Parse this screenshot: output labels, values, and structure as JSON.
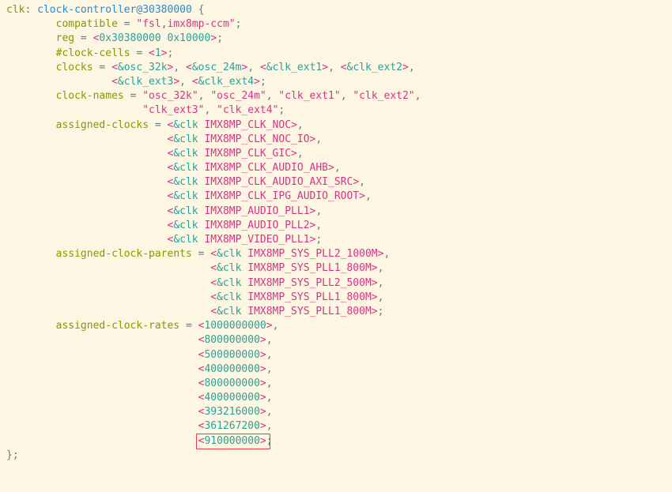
{
  "line1": {
    "label": "clk",
    "colon": ": ",
    "node": "clock-controller@30380000",
    "brace": " {"
  },
  "compatible": {
    "prop": "compatible",
    "eq": " = ",
    "q1": "\"fsl,imx8mp-ccm\"",
    "semi": ";"
  },
  "reg": {
    "prop": "reg",
    "eq": " = ",
    "lt": "<",
    "v": "0x30380000 0x10000",
    "gt": ">",
    "semi": ";"
  },
  "cells": {
    "prop": "#clock-cells",
    "eq": " = ",
    "lt": "<",
    "v": "1",
    "gt": ">",
    "semi": ";"
  },
  "clocks": {
    "prop": "clocks",
    "eq": " = ",
    "e1": {
      "lt": "<",
      "amp": "&osc_32k",
      "gt": ">"
    },
    "e2": {
      "lt": "<",
      "amp": "&osc_24m",
      "gt": ">"
    },
    "e3": {
      "lt": "<",
      "amp": "&clk_ext1",
      "gt": ">"
    },
    "e4": {
      "lt": "<",
      "amp": "&clk_ext2",
      "gt": ">"
    },
    "e5": {
      "lt": "<",
      "amp": "&clk_ext3",
      "gt": ">"
    },
    "e6": {
      "lt": "<",
      "amp": "&clk_ext4",
      "gt": ">"
    },
    "comma": ", ",
    "semi": ";"
  },
  "clocknames": {
    "prop": "clock-names",
    "eq": " = ",
    "v1": "\"osc_32k\"",
    "v2": "\"osc_24m\"",
    "v3": "\"clk_ext1\"",
    "v4": "\"clk_ext2\"",
    "v5": "\"clk_ext3\"",
    "v6": "\"clk_ext4\"",
    "comma": ", ",
    "semi": ";"
  },
  "assigned_clocks": {
    "prop": "assigned-clocks",
    "eq": " = ",
    "items": [
      {
        "lt": "<",
        "amp": "&clk ",
        "name": "IMX8MP_CLK_NOC",
        "gt": ">"
      },
      {
        "lt": "<",
        "amp": "&clk ",
        "name": "IMX8MP_CLK_NOC_IO",
        "gt": ">"
      },
      {
        "lt": "<",
        "amp": "&clk ",
        "name": "IMX8MP_CLK_GIC",
        "gt": ">"
      },
      {
        "lt": "<",
        "amp": "&clk ",
        "name": "IMX8MP_CLK_AUDIO_AHB",
        "gt": ">"
      },
      {
        "lt": "<",
        "amp": "&clk ",
        "name": "IMX8MP_CLK_AUDIO_AXI_SRC",
        "gt": ">"
      },
      {
        "lt": "<",
        "amp": "&clk ",
        "name": "IMX8MP_CLK_IPG_AUDIO_ROOT",
        "gt": ">"
      },
      {
        "lt": "<",
        "amp": "&clk ",
        "name": "IMX8MP_AUDIO_PLL1",
        "gt": ">"
      },
      {
        "lt": "<",
        "amp": "&clk ",
        "name": "IMX8MP_AUDIO_PLL2",
        "gt": ">"
      },
      {
        "lt": "<",
        "amp": "&clk ",
        "name": "IMX8MP_VIDEO_PLL1",
        "gt": ">"
      }
    ]
  },
  "assigned_parents": {
    "prop": "assigned-clock-parents",
    "eq": " = ",
    "items": [
      {
        "lt": "<",
        "amp": "&clk ",
        "name": "IMX8MP_SYS_PLL2_1000M",
        "gt": ">"
      },
      {
        "lt": "<",
        "amp": "&clk ",
        "name": "IMX8MP_SYS_PLL1_800M",
        "gt": ">"
      },
      {
        "lt": "<",
        "amp": "&clk ",
        "name": "IMX8MP_SYS_PLL2_500M",
        "gt": ">"
      },
      {
        "lt": "<",
        "amp": "&clk ",
        "name": "IMX8MP_SYS_PLL1_800M",
        "gt": ">"
      },
      {
        "lt": "<",
        "amp": "&clk ",
        "name": "IMX8MP_SYS_PLL1_800M",
        "gt": ">"
      }
    ]
  },
  "assigned_rates": {
    "prop": "assigned-clock-rates",
    "eq": " = ",
    "items": [
      {
        "lt": "<",
        "v": "1000000000",
        "gt": ">"
      },
      {
        "lt": "<",
        "v": "800000000",
        "gt": ">"
      },
      {
        "lt": "<",
        "v": "500000000",
        "gt": ">"
      },
      {
        "lt": "<",
        "v": "400000000",
        "gt": ">"
      },
      {
        "lt": "<",
        "v": "800000000",
        "gt": ">"
      },
      {
        "lt": "<",
        "v": "400000000",
        "gt": ">"
      },
      {
        "lt": "<",
        "v": "393216000",
        "gt": ">"
      },
      {
        "lt": "<",
        "v": "361267200",
        "gt": ">"
      },
      {
        "lt": "<",
        "v": "910000000",
        "gt": ">"
      }
    ]
  },
  "close": {
    "brace": "};"
  },
  "c": ",",
  "s": ";"
}
